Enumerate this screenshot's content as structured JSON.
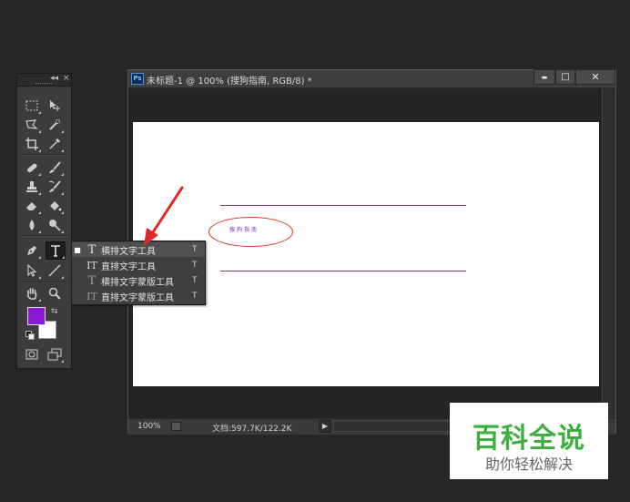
{
  "tools_panel": {
    "collapse_glyph": "◂◂",
    "close_glyph": "×"
  },
  "tools": [
    {
      "name": "marquee-tool-icon"
    },
    {
      "name": "move-tool-icon"
    },
    {
      "name": "lasso-tool-icon"
    },
    {
      "name": "quick-selection-tool-icon"
    },
    {
      "name": "crop-tool-icon"
    },
    {
      "name": "eyedropper-tool-icon"
    },
    {
      "name": "spot-healing-tool-icon"
    },
    {
      "name": "brush-tool-icon"
    },
    {
      "name": "clone-stamp-tool-icon"
    },
    {
      "name": "history-brush-tool-icon"
    },
    {
      "name": "eraser-tool-icon"
    },
    {
      "name": "paint-bucket-tool-icon"
    },
    {
      "name": "blur-tool-icon"
    },
    {
      "name": "dodge-tool-icon"
    },
    {
      "name": "pen-tool-icon"
    },
    {
      "name": "type-tool-icon"
    },
    {
      "name": "path-selection-tool-icon"
    },
    {
      "name": "line-tool-icon"
    },
    {
      "name": "hand-tool-icon"
    },
    {
      "name": "zoom-tool-icon"
    }
  ],
  "colors": {
    "foreground": "#8a18d4",
    "background": "#ffffff",
    "accent_purple": "#8a2ac8",
    "annotation_red": "#d9342b",
    "watermark_green": "#3fb040"
  },
  "flyout": {
    "items": [
      {
        "icon": "T",
        "label": "横排文字工具",
        "key": "T",
        "selected": true
      },
      {
        "icon": "IT",
        "label": "直排文字工具",
        "key": "T",
        "selected": false
      },
      {
        "icon": "T",
        "label": "横排文字蒙版工具",
        "key": "T",
        "selected": false
      },
      {
        "icon": "IT",
        "label": "直排文字蒙版工具",
        "key": "T",
        "selected": false
      }
    ]
  },
  "document": {
    "ps_badge": "Ps",
    "title": "未标题-1 @ 100% (搜狗指南, RGB/8) *",
    "minimize_glyph": "▬",
    "maximize_glyph": "□",
    "close_glyph": "✕",
    "canvas_text": "搜狗指南"
  },
  "status": {
    "zoom": "100%",
    "doc_info": "文档:597.7K/122.2K",
    "arrow_glyph": "▶"
  },
  "watermark": {
    "big": "百科全说",
    "small": "助你轻松解决"
  }
}
